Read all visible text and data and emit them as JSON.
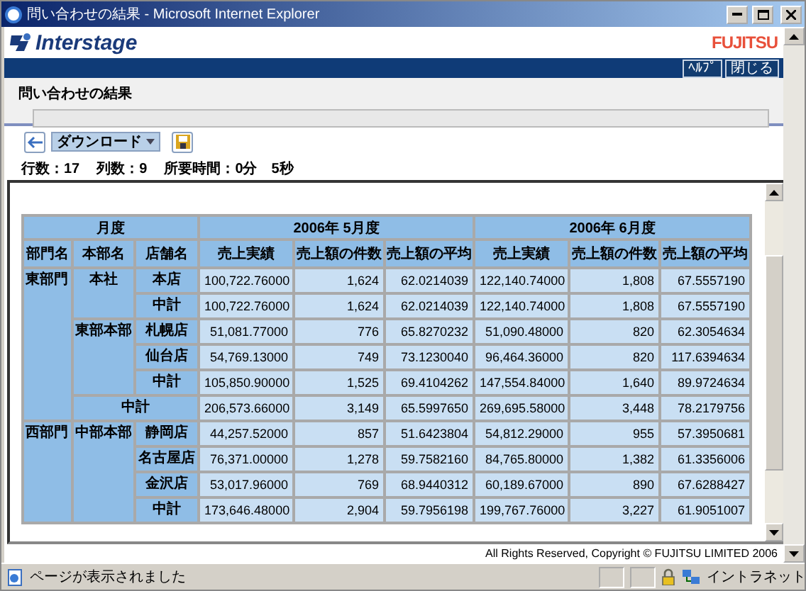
{
  "window": {
    "title": "問い合わせの結果 - Microsoft Internet Explorer"
  },
  "header": {
    "logo": "Interstage",
    "brand": "FUJITSU",
    "buttons": [
      "ﾍﾙﾌﾟ",
      "閉じる"
    ]
  },
  "page": {
    "heading": "問い合わせの結果"
  },
  "toolbar": {
    "download": "ダウンロード"
  },
  "stats": [
    "行数：17",
    "列数：9",
    "所要時間：0分　5秒"
  ],
  "table": {
    "corner": "月度",
    "dim_columns": [
      "部門名",
      "本部名",
      "店舗名"
    ],
    "months": [
      {
        "label": "2006年 5月度",
        "measures": [
          "売上実績",
          "売上額の件数",
          "売上額の平均"
        ]
      },
      {
        "label": "2006年 6月度",
        "measures": [
          "売上実績",
          "売上額の件数",
          "売上額の平均"
        ]
      }
    ],
    "departments": [
      {
        "name": "東部門",
        "divisions": [
          {
            "name": "本社",
            "rows": [
              {
                "store": "本店",
                "values": [
                  "100,722.76000",
                  "1,624",
                  "62.0214039",
                  "122,140.74000",
                  "1,808",
                  "67.5557190"
                ]
              },
              {
                "store": "中計",
                "values": [
                  "100,722.76000",
                  "1,624",
                  "62.0214039",
                  "122,140.74000",
                  "1,808",
                  "67.5557190"
                ]
              }
            ]
          },
          {
            "name": "東部本部",
            "rows": [
              {
                "store": "札幌店",
                "values": [
                  "51,081.77000",
                  "776",
                  "65.8270232",
                  "51,090.48000",
                  "820",
                  "62.3054634"
                ]
              },
              {
                "store": "仙台店",
                "values": [
                  "54,769.13000",
                  "749",
                  "73.1230040",
                  "96,464.36000",
                  "820",
                  "117.6394634"
                ]
              },
              {
                "store": "中計",
                "values": [
                  "105,850.90000",
                  "1,525",
                  "69.4104262",
                  "147,554.84000",
                  "1,640",
                  "89.9724634"
                ]
              }
            ]
          }
        ],
        "subtotal": {
          "label": "中計",
          "values": [
            "206,573.66000",
            "3,149",
            "65.5997650",
            "269,695.58000",
            "3,448",
            "78.2179756"
          ]
        }
      },
      {
        "name": "西部門",
        "divisions": [
          {
            "name": "中部本部",
            "rows": [
              {
                "store": "静岡店",
                "values": [
                  "44,257.52000",
                  "857",
                  "51.6423804",
                  "54,812.29000",
                  "955",
                  "57.3950681"
                ]
              },
              {
                "store": "名古屋店",
                "values": [
                  "76,371.00000",
                  "1,278",
                  "59.7582160",
                  "84,765.80000",
                  "1,382",
                  "61.3356006"
                ]
              },
              {
                "store": "金沢店",
                "values": [
                  "53,017.96000",
                  "769",
                  "68.9440312",
                  "60,189.67000",
                  "890",
                  "67.6288427"
                ]
              },
              {
                "store": "中計",
                "values": [
                  "173,646.48000",
                  "2,904",
                  "59.7956198",
                  "199,767.76000",
                  "3,227",
                  "61.9051007"
                ]
              }
            ]
          }
        ]
      }
    ]
  },
  "copyright": "All Rights Reserved, Copyright © FUJITSU LIMITED 2006",
  "status_bar": {
    "message": "ページが表示されました",
    "zone": "イントラネット"
  }
}
